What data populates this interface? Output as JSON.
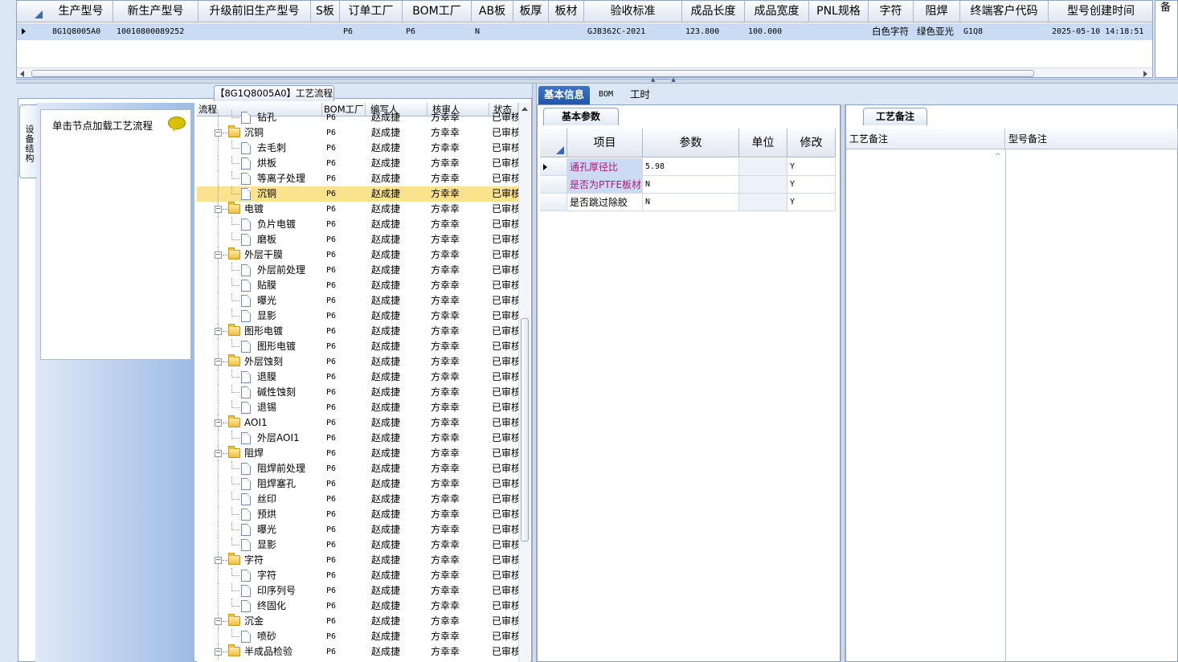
{
  "top_grid": {
    "columns": [
      "生产型号",
      "新生产型号",
      "升级前旧生产型号",
      "S板",
      "订单工厂",
      "BOM工厂",
      "AB板",
      "板厚",
      "板材",
      "验收标准",
      "成品长度",
      "成品宽度",
      "PNL规格",
      "字符",
      "阻焊",
      "终端客户代码",
      "型号创建时间"
    ],
    "row": [
      "8G1Q8005A0",
      "10010800089252",
      "",
      "",
      "P6",
      "P6",
      "N",
      "",
      "",
      "GJB362C-2021",
      "123.800",
      "100.000",
      "",
      "白色字符",
      "绿色亚光",
      "G1Q8",
      "2025-05-10 14:18:51"
    ],
    "right_header": "备"
  },
  "left_panel": {
    "vertical_tab": "设备结构",
    "hint_text": "单击节点加载工艺流程",
    "process_title": "【8G1Q8005A0】工艺流程"
  },
  "tree": {
    "headers": [
      "流程",
      "BOM工厂",
      "编写人",
      "核审人",
      "状态"
    ],
    "rows": [
      {
        "name": "钻孔",
        "bom": "P6",
        "writer": "赵成捷",
        "checker": "方幸幸",
        "status": "已审核",
        "level": 2
      },
      {
        "name": "沉铜",
        "bom": "P6",
        "writer": "赵成捷",
        "checker": "方幸幸",
        "status": "已审核",
        "level": 1
      },
      {
        "name": "去毛刺",
        "bom": "P6",
        "writer": "赵成捷",
        "checker": "方幸幸",
        "status": "已审核",
        "level": 2
      },
      {
        "name": "烘板",
        "bom": "P6",
        "writer": "赵成捷",
        "checker": "方幸幸",
        "status": "已审核",
        "level": 2
      },
      {
        "name": "等离子处理",
        "bom": "P6",
        "writer": "赵成捷",
        "checker": "方幸幸",
        "status": "已审核",
        "level": 2
      },
      {
        "name": "沉铜",
        "bom": "P6",
        "writer": "赵成捷",
        "checker": "方幸幸",
        "status": "已审核",
        "level": 2,
        "selected": true
      },
      {
        "name": "电镀",
        "bom": "P6",
        "writer": "赵成捷",
        "checker": "方幸幸",
        "status": "已审核",
        "level": 1
      },
      {
        "name": "负片电镀",
        "bom": "P6",
        "writer": "赵成捷",
        "checker": "方幸幸",
        "status": "已审核",
        "level": 2
      },
      {
        "name": "磨板",
        "bom": "P6",
        "writer": "赵成捷",
        "checker": "方幸幸",
        "status": "已审核",
        "level": 2
      },
      {
        "name": "外层干膜",
        "bom": "P6",
        "writer": "赵成捷",
        "checker": "方幸幸",
        "status": "已审核",
        "level": 1
      },
      {
        "name": "外层前处理",
        "bom": "P6",
        "writer": "赵成捷",
        "checker": "方幸幸",
        "status": "已审核",
        "level": 2
      },
      {
        "name": "贴膜",
        "bom": "P6",
        "writer": "赵成捷",
        "checker": "方幸幸",
        "status": "已审核",
        "level": 2
      },
      {
        "name": "曝光",
        "bom": "P6",
        "writer": "赵成捷",
        "checker": "方幸幸",
        "status": "已审核",
        "level": 2
      },
      {
        "name": "显影",
        "bom": "P6",
        "writer": "赵成捷",
        "checker": "方幸幸",
        "status": "已审核",
        "level": 2
      },
      {
        "name": "图形电镀",
        "bom": "P6",
        "writer": "赵成捷",
        "checker": "方幸幸",
        "status": "已审核",
        "level": 1
      },
      {
        "name": "图形电镀",
        "bom": "P6",
        "writer": "赵成捷",
        "checker": "方幸幸",
        "status": "已审核",
        "level": 2
      },
      {
        "name": "外层蚀刻",
        "bom": "P6",
        "writer": "赵成捷",
        "checker": "方幸幸",
        "status": "已审核",
        "level": 1
      },
      {
        "name": "退膜",
        "bom": "P6",
        "writer": "赵成捷",
        "checker": "方幸幸",
        "status": "已审核",
        "level": 2
      },
      {
        "name": "碱性蚀刻",
        "bom": "P6",
        "writer": "赵成捷",
        "checker": "方幸幸",
        "status": "已审核",
        "level": 2
      },
      {
        "name": "退锡",
        "bom": "P6",
        "writer": "赵成捷",
        "checker": "方幸幸",
        "status": "已审核",
        "level": 2
      },
      {
        "name": "AOI1",
        "bom": "P6",
        "writer": "赵成捷",
        "checker": "方幸幸",
        "status": "已审核",
        "level": 1
      },
      {
        "name": "外层AOI1",
        "bom": "P6",
        "writer": "赵成捷",
        "checker": "方幸幸",
        "status": "已审核",
        "level": 2
      },
      {
        "name": "阻焊",
        "bom": "P6",
        "writer": "赵成捷",
        "checker": "方幸幸",
        "status": "已审核",
        "level": 1
      },
      {
        "name": "阻焊前处理",
        "bom": "P6",
        "writer": "赵成捷",
        "checker": "方幸幸",
        "status": "已审核",
        "level": 2
      },
      {
        "name": "阻焊塞孔",
        "bom": "P6",
        "writer": "赵成捷",
        "checker": "方幸幸",
        "status": "已审核",
        "level": 2
      },
      {
        "name": "丝印",
        "bom": "P6",
        "writer": "赵成捷",
        "checker": "方幸幸",
        "status": "已审核",
        "level": 2
      },
      {
        "name": "预烘",
        "bom": "P6",
        "writer": "赵成捷",
        "checker": "方幸幸",
        "status": "已审核",
        "level": 2
      },
      {
        "name": "曝光",
        "bom": "P6",
        "writer": "赵成捷",
        "checker": "方幸幸",
        "status": "已审核",
        "level": 2
      },
      {
        "name": "显影",
        "bom": "P6",
        "writer": "赵成捷",
        "checker": "方幸幸",
        "status": "已审核",
        "level": 2
      },
      {
        "name": "字符",
        "bom": "P6",
        "writer": "赵成捷",
        "checker": "方幸幸",
        "status": "已审核",
        "level": 1
      },
      {
        "name": "字符",
        "bom": "P6",
        "writer": "赵成捷",
        "checker": "方幸幸",
        "status": "已审核",
        "level": 2
      },
      {
        "name": "印序列号",
        "bom": "P6",
        "writer": "赵成捷",
        "checker": "方幸幸",
        "status": "已审核",
        "level": 2
      },
      {
        "name": "终固化",
        "bom": "P6",
        "writer": "赵成捷",
        "checker": "方幸幸",
        "status": "已审核",
        "level": 2
      },
      {
        "name": "沉金",
        "bom": "P6",
        "writer": "赵成捷",
        "checker": "方幸幸",
        "status": "已审核",
        "level": 1
      },
      {
        "name": "喷砂",
        "bom": "P6",
        "writer": "赵成捷",
        "checker": "方幸幸",
        "status": "已审核",
        "level": 2
      },
      {
        "name": "半成品检验",
        "bom": "P6",
        "writer": "赵成捷",
        "checker": "方幸幸",
        "status": "已审核",
        "level": 1
      }
    ]
  },
  "right_tabs": [
    "基本信息",
    "BOM",
    "工时"
  ],
  "params": {
    "tab": "基本参数",
    "headers": [
      "项目",
      "参数",
      "单位",
      "修改"
    ],
    "rows": [
      {
        "item": "通孔厚径比",
        "value": "5.98",
        "unit": "",
        "modify": "Y",
        "highlight": true
      },
      {
        "item": "是否为PTFE板材",
        "value": "N",
        "unit": "",
        "modify": "Y",
        "highlight": true
      },
      {
        "item": "是否跳过除胶",
        "value": "N",
        "unit": "",
        "modify": "Y",
        "highlight": false
      }
    ]
  },
  "notes": {
    "tab": "工艺备注",
    "col1": "工艺备注",
    "col2": "型号备注"
  },
  "colors": {
    "accent": "#1f55a8",
    "selected_row": "#fbe28e",
    "grid_row": "#c9dcf3",
    "highlight_text": "#b0157a"
  }
}
